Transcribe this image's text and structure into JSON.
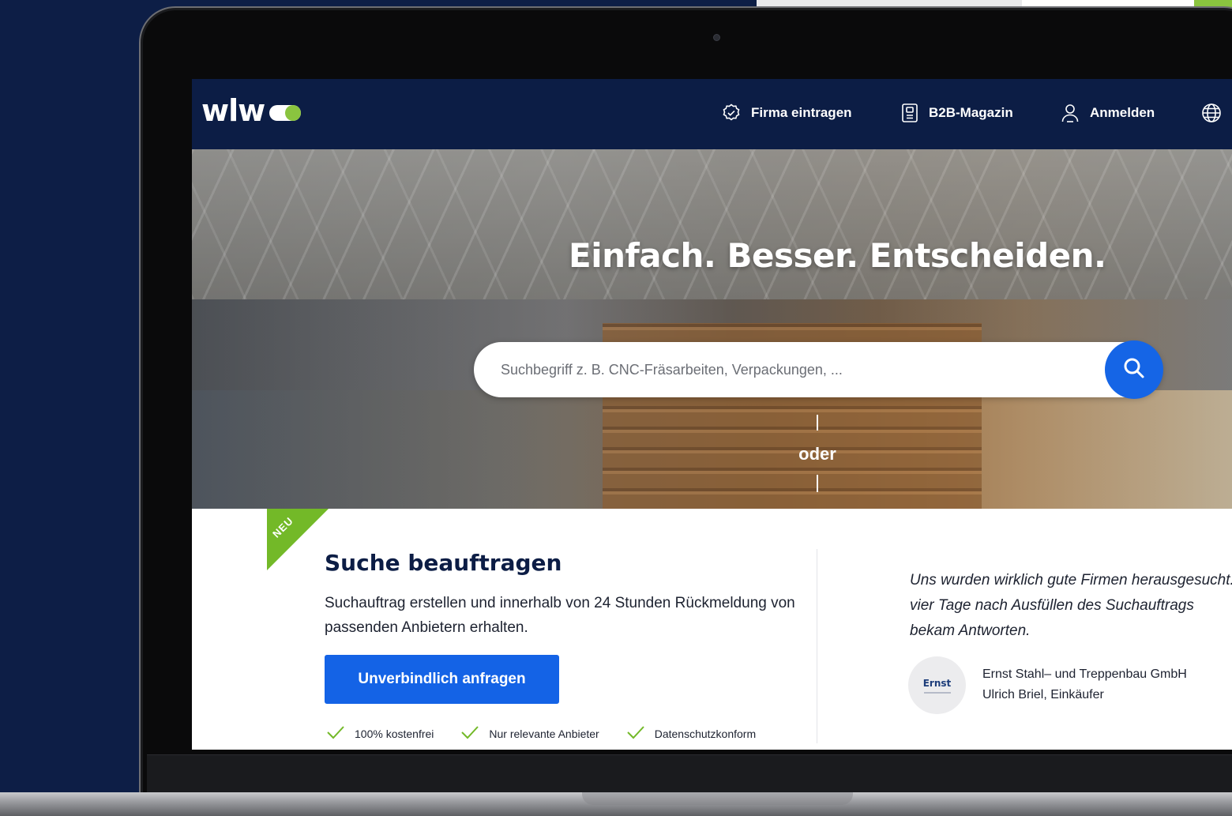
{
  "header": {
    "logo_text": "wlw",
    "nav": [
      {
        "label": "Firma eintragen",
        "icon": "badge-check-icon"
      },
      {
        "label": "B2B-Magazin",
        "icon": "document-icon"
      },
      {
        "label": "Anmelden",
        "icon": "user-icon"
      },
      {
        "label": "",
        "icon": "globe-icon"
      }
    ]
  },
  "hero": {
    "headline": "Einfach. Besser. Entscheiden.",
    "search_placeholder": "Suchbegriff z. B. CNC-Fräsarbeiten, Verpackungen, ...",
    "search_icon": "search-icon",
    "separator": "oder"
  },
  "card": {
    "badge": "NEU",
    "title": "Suche beauftragen",
    "description": "Suchauftrag erstellen und innerhalb von 24 Stunden Rückmeldung von passenden Anbietern erhalten.",
    "cta_label": "Unverbindlich anfragen",
    "features": [
      "100% kostenfrei",
      "Nur relevante Anbieter",
      "Datenschutzkonform"
    ]
  },
  "testimonial": {
    "quote": "Uns wurden wirklich gute Firmen herausgesucht. vier Tage nach Ausfüllen des Suchauftrags bekam Antworten.",
    "logo_word": "Ernst",
    "company": "Ernst Stahl– und Treppenbau GmbH",
    "person": "Ulrich Briel, Einkäufer"
  },
  "colors": {
    "navy": "#0c1d45",
    "page_background": "#0d1e46",
    "accent_blue": "#1463e6",
    "accent_green": "#73b928"
  }
}
